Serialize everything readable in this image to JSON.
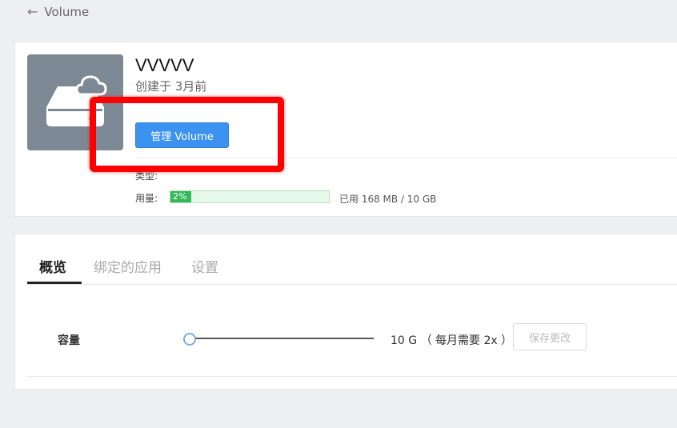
{
  "header": {
    "back_label": "Volume"
  },
  "volume": {
    "name": "VVVVV",
    "created": "创建于 3月前",
    "manage_button": "管理 Volume",
    "type_label": "类型:",
    "usage_label": "用量:",
    "usage_percent_label": "2%",
    "usage_fraction": 0.02,
    "usage_text": "已用 168 MB / 10 GB"
  },
  "tabs": [
    {
      "label": "概览",
      "active": true
    },
    {
      "label": "绑定的应用",
      "active": false
    },
    {
      "label": "设置",
      "active": false
    }
  ],
  "overview": {
    "capacity_label": "容量",
    "capacity_value": "10 G （ 每月需要 2x ）",
    "save_button": "保存更改"
  },
  "colors": {
    "accent": "#3b92f0",
    "usage_fill": "#35b859",
    "highlight": "#ff0000"
  }
}
